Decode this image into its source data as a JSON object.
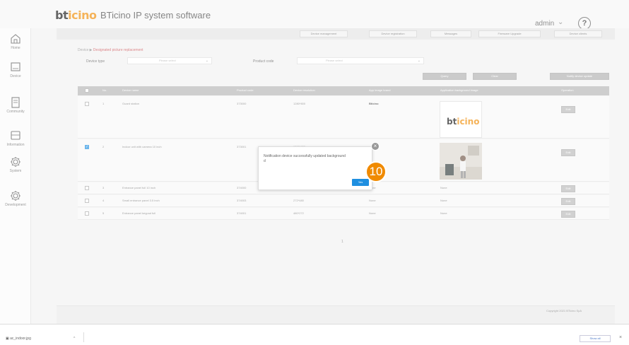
{
  "header": {
    "logo_b": "bt",
    "logo_t": "icino",
    "app_title": "BTicino IP system software",
    "user": "admin",
    "help": "?"
  },
  "sidebar": {
    "items": [
      {
        "label": "Home",
        "icon": "home-icon"
      },
      {
        "label": "Device",
        "icon": "device-icon"
      },
      {
        "label": "Community",
        "icon": "community-icon"
      },
      {
        "label": "Information",
        "icon": "information-icon"
      },
      {
        "label": "System",
        "icon": "gear-icon"
      },
      {
        "label": "Development",
        "icon": "gear-icon"
      }
    ]
  },
  "toolbar": {
    "buttons": [
      "Device management",
      "Device registration",
      "Messages",
      "Firmware Upgrade",
      "Device clients"
    ]
  },
  "breadcrumb": {
    "root": "Device",
    "current": "Designated picture replacement"
  },
  "filters": {
    "device_type_label": "Device type",
    "device_type_placeholder": "Please select",
    "product_code_label": "Product code",
    "product_code_placeholder": "Please select"
  },
  "actions": {
    "query": "Query",
    "clear": "Clear",
    "notify": "Notify device update"
  },
  "table": {
    "headers": [
      "No.",
      "Device name",
      "Product code",
      "Device resolution",
      "App image brand",
      "Application background image",
      "Operation"
    ],
    "rows": [
      {
        "checked": false,
        "no": "1",
        "name": "Guard station",
        "code": "373000",
        "resolution": "1280*800",
        "brand": "Bticino",
        "image": "logo",
        "op": "Edit"
      },
      {
        "checked": true,
        "no": "2",
        "name": "Indoor unit with camera 10 inch",
        "code": "373001",
        "resolution": "1280*800",
        "brand": "",
        "image": "photo",
        "op": "Edit"
      },
      {
        "checked": false,
        "no": "3",
        "name": "Entrance panel full 10 inch",
        "code": "374000",
        "resolution": "",
        "brand": "None",
        "image": "None",
        "op": "Edit"
      },
      {
        "checked": false,
        "no": "4",
        "name": "Small entrance panel 3.5 inch",
        "code": "374003",
        "resolution": "272*480",
        "brand": "None",
        "image": "None",
        "op": "Edit"
      },
      {
        "checked": false,
        "no": "5",
        "name": "Entrance panel keypad full",
        "code": "374001",
        "resolution": "480*272",
        "brand": "None",
        "image": "None",
        "op": "Edit"
      }
    ]
  },
  "pager": {
    "page": "1"
  },
  "footer": {
    "copyright": "Copyright 2021 BTicino SpA"
  },
  "modal": {
    "message": "Notification device successfully updated background",
    "message_tail": "d",
    "yes": "Yes",
    "close": "×",
    "step": "10"
  },
  "taskbar": {
    "file": "ac_indoor.jpg",
    "chevron": "^",
    "show_all": "Show all",
    "close": "×"
  },
  "colors": {
    "brand_orange": "#f08a00",
    "accent_blue": "#1f8fe0",
    "breadcrumb_red": "#c8454a"
  }
}
